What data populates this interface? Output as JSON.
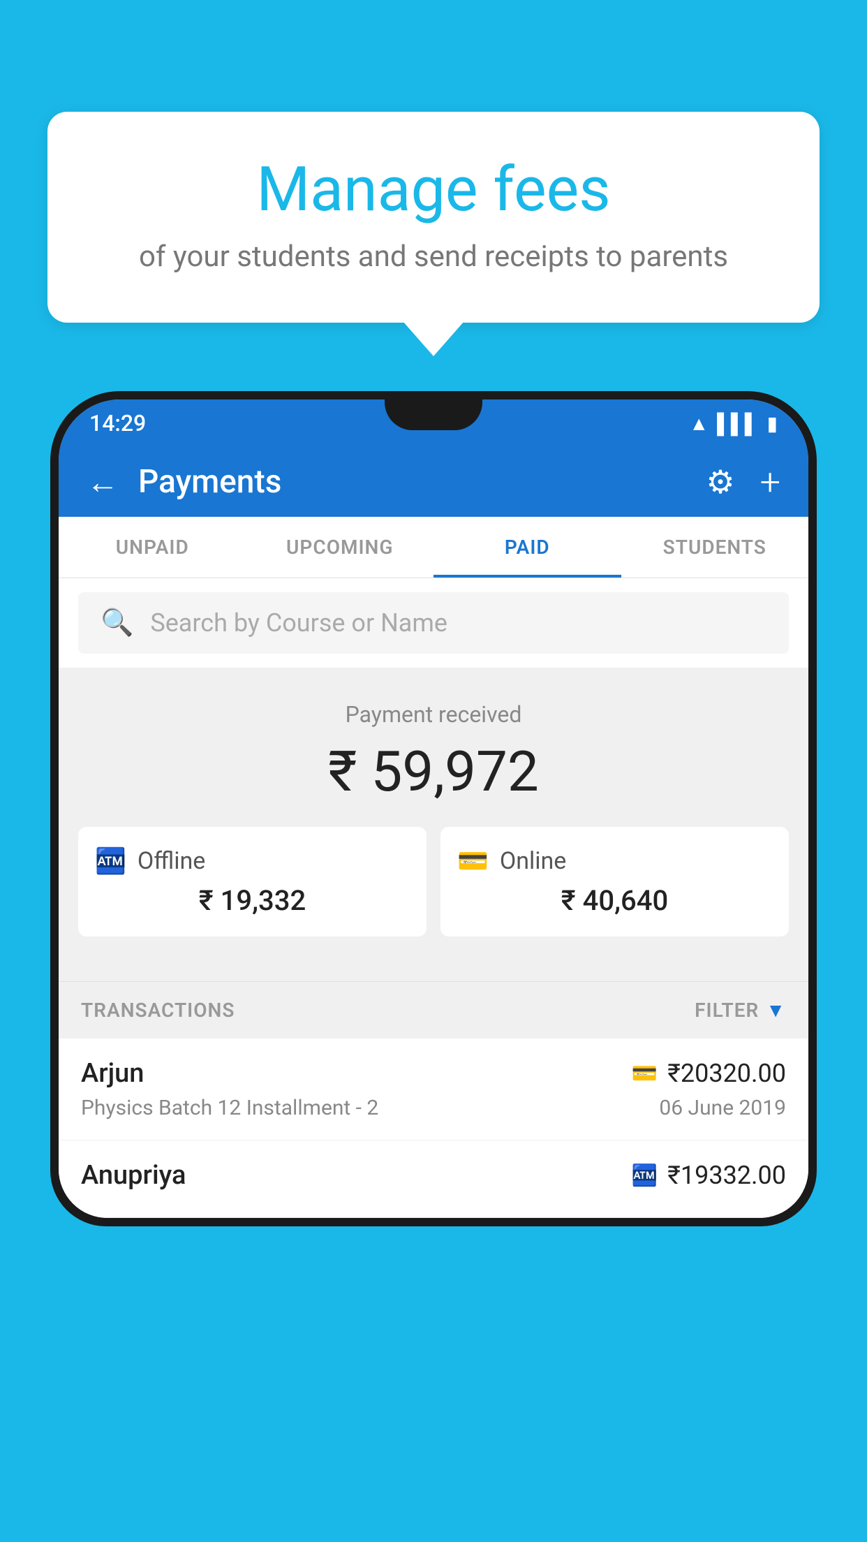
{
  "background_color": "#1ab8e8",
  "bubble": {
    "title": "Manage fees",
    "subtitle": "of your students and send receipts to parents"
  },
  "phone": {
    "status_bar": {
      "time": "14:29"
    },
    "header": {
      "title": "Payments",
      "back_label": "←",
      "gear_label": "⚙",
      "plus_label": "+"
    },
    "tabs": [
      {
        "label": "UNPAID",
        "active": false
      },
      {
        "label": "UPCOMING",
        "active": false
      },
      {
        "label": "PAID",
        "active": true
      },
      {
        "label": "STUDENTS",
        "active": false
      }
    ],
    "search": {
      "placeholder": "Search by Course or Name"
    },
    "payment_summary": {
      "label": "Payment received",
      "amount": "₹ 59,972",
      "offline": {
        "label": "Offline",
        "amount": "₹ 19,332"
      },
      "online": {
        "label": "Online",
        "amount": "₹ 40,640"
      }
    },
    "transactions": {
      "header_label": "TRANSACTIONS",
      "filter_label": "FILTER",
      "rows": [
        {
          "name": "Arjun",
          "course": "Physics Batch 12 Installment - 2",
          "amount": "₹20320.00",
          "date": "06 June 2019",
          "payment_type": "card"
        },
        {
          "name": "Anupriya",
          "course": "",
          "amount": "₹19332.00",
          "date": "",
          "payment_type": "cash"
        }
      ]
    }
  }
}
